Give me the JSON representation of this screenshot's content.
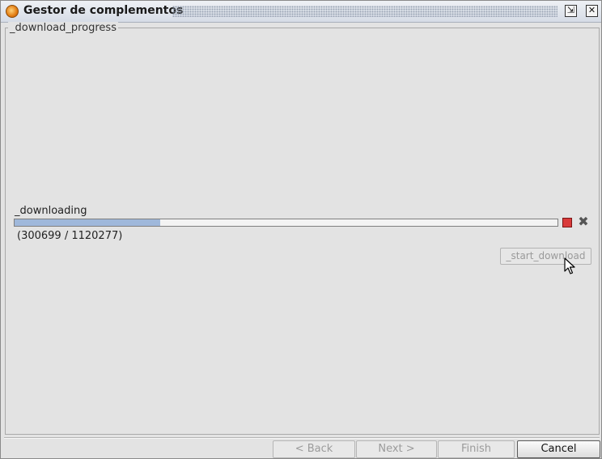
{
  "window": {
    "title": "Gestor de complementos",
    "icon": "gvsig-app-icon"
  },
  "panel": {
    "group_title": "_download_progress",
    "status_label": "_downloading",
    "progress_fraction": 0.2684,
    "bytes_text": "(300699 / 1120277)",
    "start_button": "_start_download",
    "colors": {
      "progress_fill": "#9fb8db",
      "stop": "#d93a3a"
    }
  },
  "footer": {
    "back": "< Back",
    "next": "Next >",
    "finish": "Finish",
    "cancel": "Cancel"
  }
}
